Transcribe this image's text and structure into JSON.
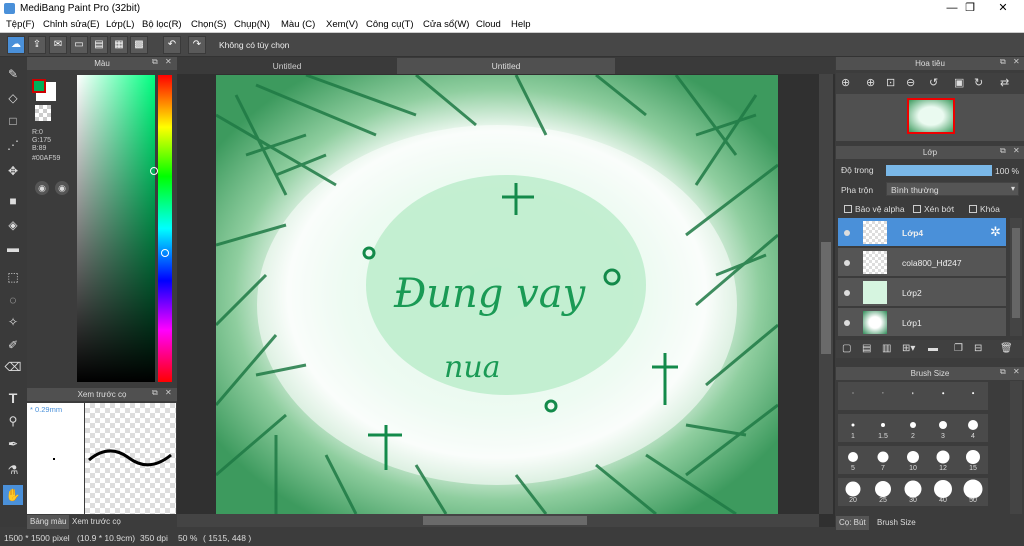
{
  "window": {
    "title": "MediBang Paint Pro (32bit)",
    "minimize": "—",
    "maximize": "❐",
    "close": "✕"
  },
  "menu": [
    "Tệp(F)",
    "Chỉnh sửa(E)",
    "Lớp(L)",
    "Bộ lọc(R)",
    "Chọn(S)",
    "Chụp(N)",
    "Màu (C)",
    "Xem(V)",
    "Công cụ(T)",
    "Cửa sổ(W)",
    "Cloud",
    "Help"
  ],
  "toolbar": {
    "hint": "Không có tùy chọn",
    "undo": "↶",
    "redo": "↷"
  },
  "color_panel": {
    "title": "Màu",
    "r": "R:0",
    "g": "G:175",
    "b": "B:89",
    "hex": "#00AF59"
  },
  "brush_preview": {
    "title": "Xem trước cọ",
    "size": "* 0.29mm",
    "tab_palette": "Bảng màu",
    "tab_preview": "Xem trước cọ"
  },
  "canvas": {
    "tabs": [
      "Untitled",
      "Untitled"
    ],
    "text_line1": "Đung vay",
    "text_line2": "nua"
  },
  "navigator": {
    "title": "Hoa tiêu"
  },
  "layers": {
    "title": "Lớp",
    "opacity_label": "Độ trong",
    "opacity_value": "100 %",
    "opacity_fraction": 1.0,
    "blend_label": "Pha trộn",
    "blend_value": "Bình thường",
    "protect_alpha": "Bảo vệ alpha",
    "clip": "Xén bớt",
    "lock": "Khóa",
    "items": [
      {
        "name": "Lớp4",
        "selected": true
      },
      {
        "name": "cola800_Hđ247",
        "selected": false
      },
      {
        "name": "Lớp2",
        "selected": false
      },
      {
        "name": "Lớp1",
        "selected": false
      }
    ]
  },
  "brush_size": {
    "title": "Brush Size",
    "tab_brush": "Cọ: Bút",
    "tab_size": "Brush Size",
    "sizes": [
      "",
      "",
      "",
      "",
      "",
      "1",
      "1.5",
      "2",
      "3",
      "4",
      "5",
      "7",
      "10",
      "12",
      "15",
      "20",
      "25",
      "30",
      "40",
      "50"
    ]
  },
  "status": {
    "dimensions": "1500 * 1500 pixel",
    "physical": "(10.9 * 10.9cm)",
    "dpi": "350 dpi",
    "zoom": "50 %",
    "coords": "( 1515, 448 )"
  },
  "colors": {
    "accent": "#4a90d9",
    "fg": "#00AF59",
    "leaf": "#2e8b57"
  }
}
